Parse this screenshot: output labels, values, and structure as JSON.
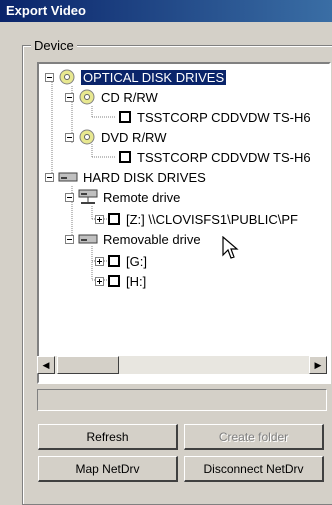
{
  "window": {
    "title": "Export Video"
  },
  "device_group": {
    "label": "Device"
  },
  "tree": {
    "optical": {
      "label": "OPTICAL DISK DRIVES"
    },
    "cdrw": {
      "label": "CD R/RW"
    },
    "cdrw_device": {
      "label": "TSSTCORP CDDVDW TS-H6"
    },
    "dvdrw": {
      "label": "DVD R/RW"
    },
    "dvdrw_device": {
      "label": "TSSTCORP CDDVDW TS-H6"
    },
    "hdd": {
      "label": "HARD DISK DRIVES"
    },
    "remote": {
      "label": "Remote drive"
    },
    "remote_z": {
      "label": "[Z:] \\\\CLOVISFS1\\PUBLIC\\PF"
    },
    "removable": {
      "label": "Removable drive"
    },
    "drive_g": {
      "label": "[G:]"
    },
    "drive_h": {
      "label": "[H:]"
    }
  },
  "path_field": {
    "value": ""
  },
  "buttons": {
    "refresh": "Refresh",
    "create_folder": "Create folder",
    "map_netdrv": "Map NetDrv",
    "disconnect_netdrv": "Disconnect NetDrv"
  },
  "colors": {
    "selection": "#0a246a",
    "window_bg": "#d4d0c8",
    "title_start": "#0a246a"
  }
}
